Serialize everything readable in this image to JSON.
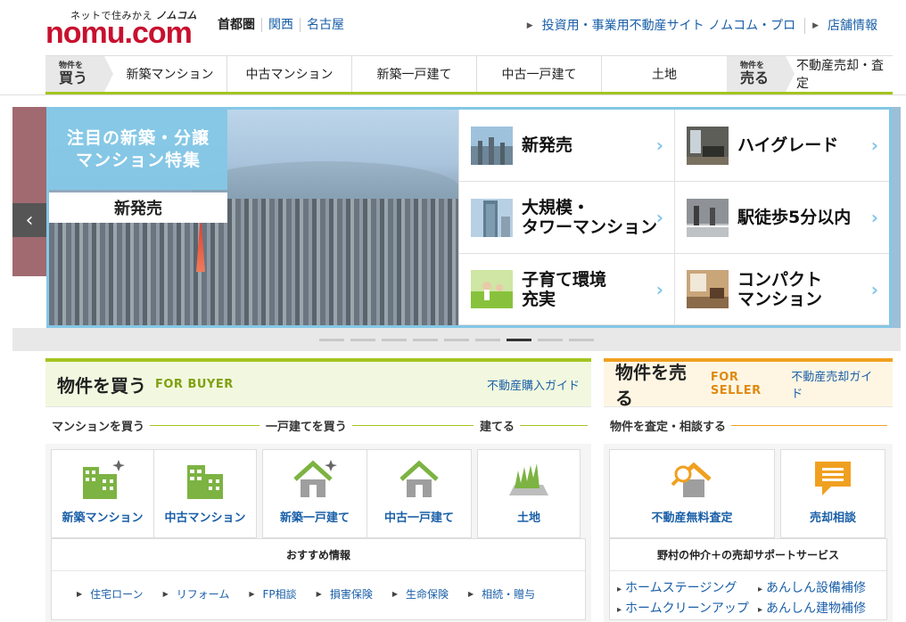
{
  "header": {
    "tagline_prefix": "ネットで住みかえ",
    "tagline_brand": "ノムコム",
    "logo_text": "nomu.com",
    "regions": [
      "首都圏",
      "関西",
      "名古屋"
    ],
    "top_links": [
      "投資用・事業用不動産サイト ノムコム・プロ",
      "店舗情報"
    ]
  },
  "nav": {
    "buy_tag_small": "物件を",
    "buy_tag_big": "買う",
    "buy_items": [
      "新築マンション",
      "中古マンション",
      "新築一戸建て",
      "中古一戸建て",
      "土地"
    ],
    "sell_tag_small": "物件を",
    "sell_tag_big": "売る",
    "sell_items": [
      "不動産売却・査定"
    ]
  },
  "hero": {
    "title_line1": "注目の新築・分譲",
    "title_line2": "マンション特集",
    "badge": "新発売",
    "prev_label": "‹",
    "tiles": [
      {
        "label": "新発売",
        "icon": "city-photo"
      },
      {
        "label": "ハイグレード",
        "icon": "interior-photo"
      },
      {
        "label": "大規模・\nタワーマンション",
        "icon": "tower-photo"
      },
      {
        "label": "駅徒歩5分以内",
        "icon": "station-photo"
      },
      {
        "label": "子育て環境\n充実",
        "icon": "park-photo"
      },
      {
        "label": "コンパクト\nマンション",
        "icon": "room-photo"
      }
    ],
    "active_dot": 6,
    "dot_count": 9
  },
  "buyer": {
    "title": "物件を買う",
    "title_en": "FOR BUYER",
    "guide": "不動産購入ガイド",
    "categories": [
      "マンションを買う",
      "一戸建てを買う",
      "建てる"
    ],
    "tiles": [
      "新築マンション",
      "中古マンション",
      "新築一戸建て",
      "中古一戸建て",
      "土地"
    ],
    "info_title": "おすすめ情報",
    "info_links": [
      "住宅ローン",
      "リフォーム",
      "FP相談",
      "損害保険",
      "生命保険",
      "相続・贈与"
    ]
  },
  "seller": {
    "title": "物件を売る",
    "title_en": "FOR SELLER",
    "guide": "不動産売却ガイド",
    "category": "物件を査定・相談する",
    "tiles": [
      "不動産無料査定",
      "売却相談"
    ],
    "info_title": "野村の仲介＋の売却サポートサービス",
    "support_links": [
      "ホームステージング",
      "あんしん設備補修",
      "ホームクリーンアップ",
      "あんしん建物補修"
    ]
  },
  "colors": {
    "brand": "#c8102e",
    "buyer_accent": "#a4c420",
    "seller_accent": "#f0a020",
    "link": "#1a5fa8",
    "hero_frame": "#84c7e6"
  }
}
